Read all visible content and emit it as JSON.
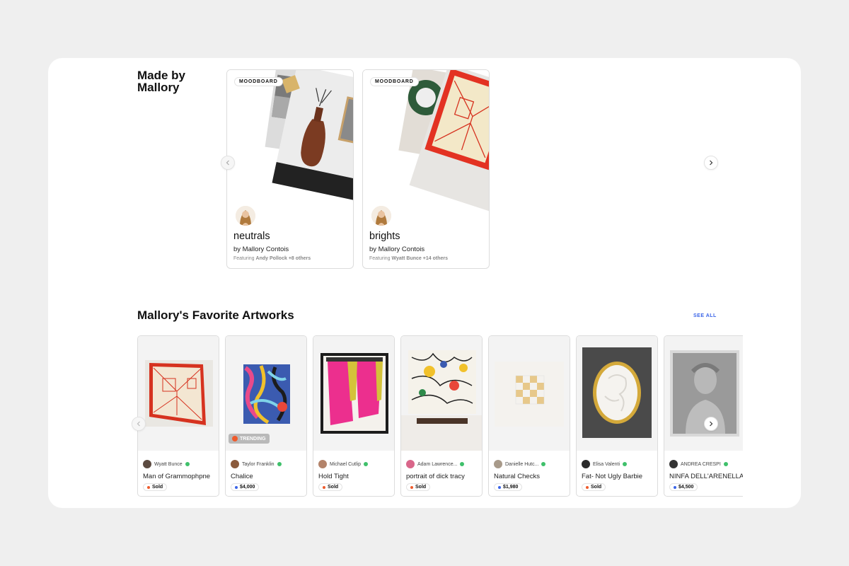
{
  "made_by": {
    "title": "Made by Mallory",
    "cards": [
      {
        "badge": "MOODBOARD",
        "name": "neutrals",
        "by": "by Mallory Contois",
        "featuring_label": "Featuring",
        "featuring_artist": "Andy Pollock",
        "featuring_more": "+8 others"
      },
      {
        "badge": "MOODBOARD",
        "name": "brights",
        "by": "by Mallory Contois",
        "featuring_label": "Featuring",
        "featuring_artist": "Wyatt Bunce",
        "featuring_more": "+14 others"
      }
    ]
  },
  "favorites": {
    "title": "Mallory's Favorite Artworks",
    "see_all": "SEE ALL",
    "trending_label": "TRENDING",
    "artworks": [
      {
        "artist": "Wyatt Bunce",
        "title": "Man of Grammophpne",
        "price": "Sold",
        "status": "sold"
      },
      {
        "artist": "Taylor Franklin",
        "title": "Chalice",
        "price": "$4,000",
        "status": "available"
      },
      {
        "artist": "Michael Cutlip",
        "title": "Hold Tight",
        "price": "Sold",
        "status": "sold"
      },
      {
        "artist": "Adam Lawrence...",
        "title": "portrait of dick tracy",
        "price": "Sold",
        "status": "sold"
      },
      {
        "artist": "Danielle Hutc...",
        "title": "Natural Checks",
        "price": "$1,980",
        "status": "available"
      },
      {
        "artist": "Elisa Valenti",
        "title": "Fat- Not Ugly Barbie",
        "price": "Sold",
        "status": "sold"
      },
      {
        "artist": "ANDREA CRESPI",
        "title": "NINFA DELL'ARENELLA",
        "price": "$4,500",
        "status": "available"
      }
    ]
  },
  "colors": {
    "sold": "#ef5b2c",
    "available": "#3a64e8",
    "verified": "#3fc06b",
    "link": "#3a64e8"
  }
}
